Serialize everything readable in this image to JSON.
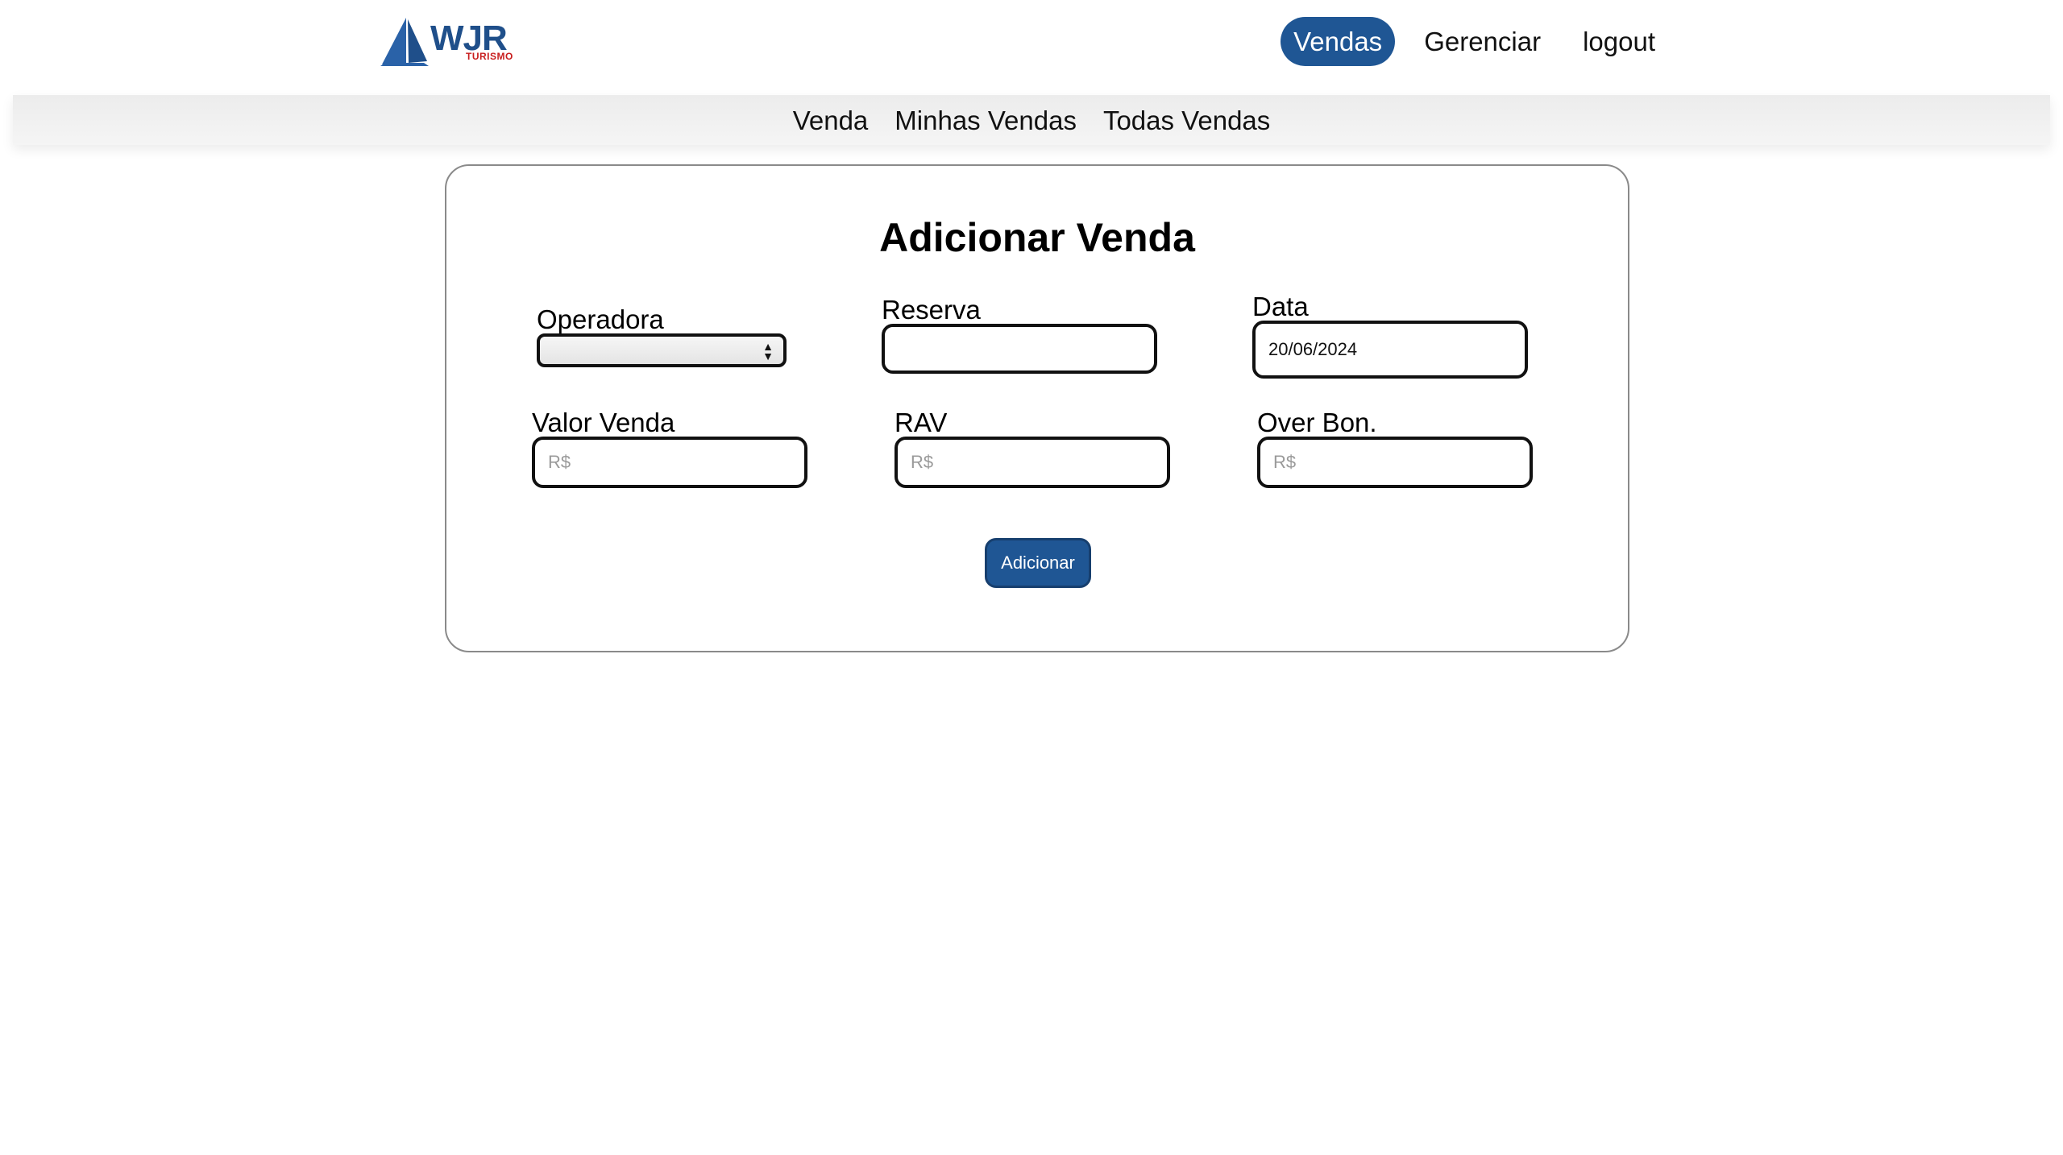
{
  "brand": {
    "name": "WJR",
    "sub": "TURISMO"
  },
  "main_nav": [
    {
      "label": "Vendas",
      "active": true
    },
    {
      "label": "Gerenciar",
      "active": false
    },
    {
      "label": "logout",
      "active": false
    }
  ],
  "sub_nav": [
    "Venda",
    "Minhas Vendas",
    "Todas Vendas"
  ],
  "form": {
    "title": "Adicionar Venda",
    "operadora_label": "Operadora",
    "operadora_value": "",
    "reserva_label": "Reserva",
    "reserva_value": "",
    "data_label": "Data",
    "data_value": "20/06/2024",
    "valor_venda_label": "Valor Venda",
    "valor_venda_placeholder": "R$",
    "rav_label": "RAV",
    "rav_placeholder": "R$",
    "over_bon_label": "Over Bon.",
    "over_bon_placeholder": "R$",
    "submit_label": "Adicionar"
  },
  "colors": {
    "primary": "#1f5694",
    "brand_red": "#c81e1e"
  }
}
